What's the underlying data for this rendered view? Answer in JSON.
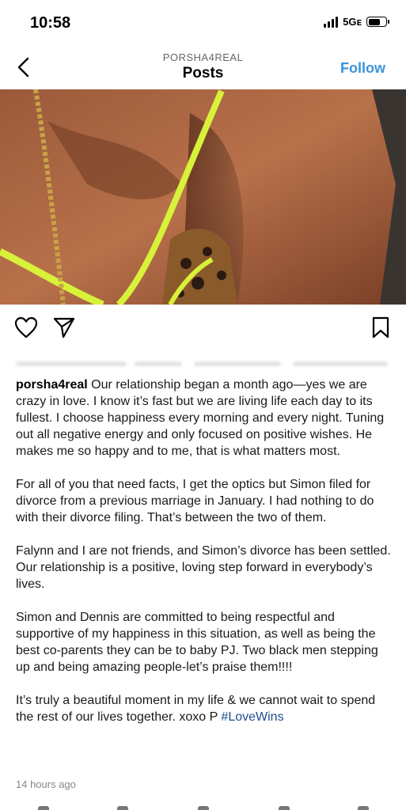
{
  "status_bar": {
    "time": "10:58",
    "network": "5Gᴇ"
  },
  "header": {
    "username": "PORSHA4REAL",
    "title": "Posts",
    "follow_label": "Follow"
  },
  "icons": {
    "back": "chevron-left-icon",
    "like": "heart-icon",
    "share": "paper-plane-icon",
    "save": "bookmark-icon"
  },
  "colors": {
    "follow": "#3b94d9",
    "hashtag": "#1f4e8c",
    "bikini_trim": "#d8f23a"
  },
  "caption": {
    "username": "porsha4real",
    "p1": "Our relationship began a month ago—yes we are crazy in love. I know it’s fast but we are living life each day to its fullest. I choose happiness every morning and every night. Tuning out all negative energy and only focused on positive wishes. He makes me so happy and to me, that is what matters most.",
    "p2": "For all of you that need facts, I get the optics but Simon filed for divorce from a previous marriage in January. I had nothing to do with their divorce filing. That’s between the two of them.",
    "p3": "Falynn and I are not friends, and Simon’s divorce has been settled. Our relationship is a positive, loving step forward in everybody’s lives.",
    "p4": "Simon and Dennis are committed to being respectful and supportive of my happiness in this situation, as well as being the best co-parents they can be to baby PJ. Two black men stepping up and being amazing people-let’s praise them!!!!",
    "p5": "It’s truly a beautiful moment in my life & we cannot wait to spend the rest of our lives together. xoxo P",
    "hashtag": "#LoveWins"
  },
  "timestamp": "14 hours ago"
}
